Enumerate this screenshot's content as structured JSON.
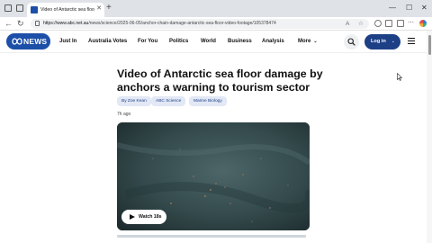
{
  "browser": {
    "tab_title": "Video of Antarctic sea floor dam",
    "url_host": "https://www.abc.net.au",
    "url_path": "/news/science/2025-06-05/anchor-chain-damage-antarctic-sea-floor-video-footage/105378474",
    "win_minimize": "—",
    "win_maximize": "☐",
    "win_close": "✕",
    "new_tab": "+",
    "tab_close": "✕",
    "back": "←",
    "reload": "↻"
  },
  "site": {
    "logo_text": "NEWS",
    "nav": [
      "Just In",
      "Australia Votes",
      "For You",
      "Politics",
      "World",
      "Business",
      "Analysis",
      "More"
    ],
    "more_chevron": "⌄",
    "login_label": "Log in",
    "login_chevron": "⌄"
  },
  "article": {
    "headline": "Video of Antarctic sea floor damage by anchors a warning to tourism sector",
    "tags": [
      "By Zoe Kean",
      "ABC Science",
      "Marine Biology"
    ],
    "time_ago": "7h ago",
    "video_button": "Watch 18s"
  },
  "colors": {
    "brand": "#1c4fa8",
    "login": "#1c3f86",
    "tag_bg": "#e2e8f5"
  }
}
